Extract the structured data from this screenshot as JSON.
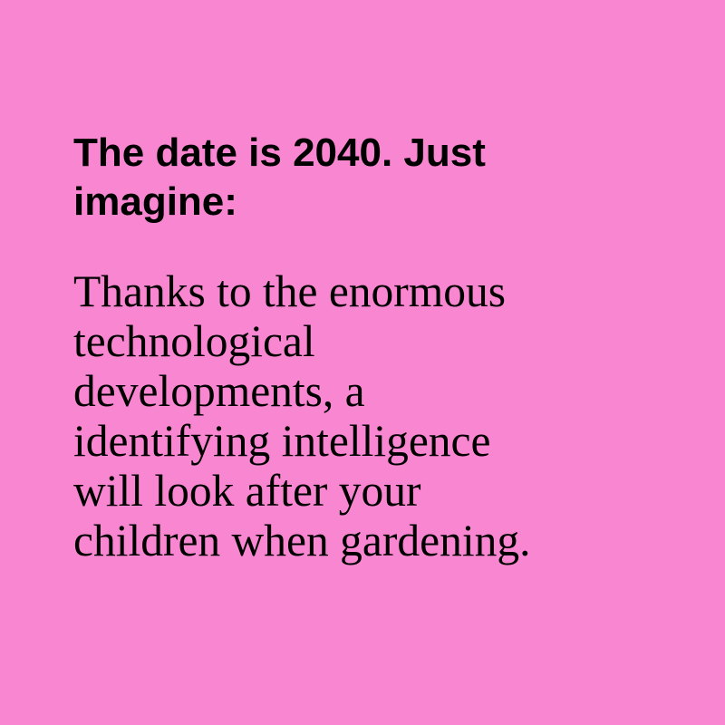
{
  "heading": {
    "lines": [
      "The date is 2040. Just",
      "imagine:"
    ]
  },
  "body": {
    "lines": [
      "Thanks to the enormous",
      "technological",
      "developments, a",
      "identifying intelligence",
      "will look after your",
      "children when gardening."
    ]
  },
  "colors": {
    "background": "#f986d1",
    "text": "#000000"
  }
}
